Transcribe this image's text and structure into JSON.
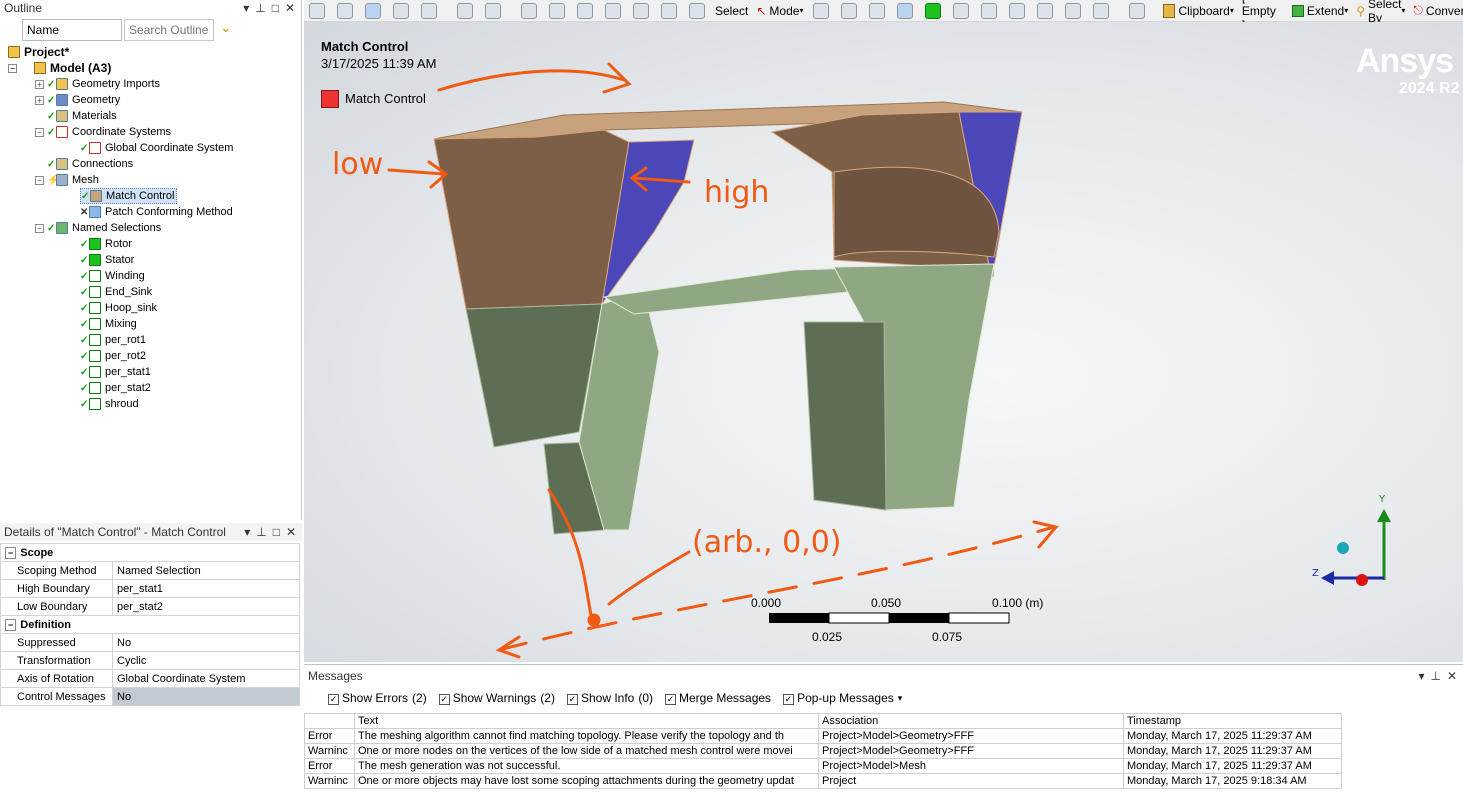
{
  "outline": {
    "title": "Outline",
    "filter_value": "Name",
    "search_placeholder": "Search Outline",
    "tree": [
      {
        "label": "Project*"
      },
      {
        "label": "Model (A3)"
      },
      {
        "label": "Geometry Imports"
      },
      {
        "label": "Geometry"
      },
      {
        "label": "Materials"
      },
      {
        "label": "Coordinate Systems"
      },
      {
        "label": "Global Coordinate System"
      },
      {
        "label": "Connections"
      },
      {
        "label": "Mesh"
      },
      {
        "label": "Match Control"
      },
      {
        "label": "Patch Conforming Method"
      },
      {
        "label": "Named Selections"
      },
      {
        "label": "Rotor"
      },
      {
        "label": "Stator"
      },
      {
        "label": "Winding"
      },
      {
        "label": "End_Sink"
      },
      {
        "label": "Hoop_sink"
      },
      {
        "label": "Mixing"
      },
      {
        "label": "per_rot1"
      },
      {
        "label": "per_rot2"
      },
      {
        "label": "per_stat1"
      },
      {
        "label": "per_stat2"
      },
      {
        "label": "shroud"
      }
    ]
  },
  "details": {
    "title": "Details of \"Match Control\" - Match Control",
    "groups": [
      {
        "name": "Scope",
        "rows": [
          {
            "key": "Scoping Method",
            "value": "Named Selection"
          },
          {
            "key": "High Boundary",
            "value": "per_stat1"
          },
          {
            "key": "Low Boundary",
            "value": "per_stat2"
          }
        ]
      },
      {
        "name": "Definition",
        "rows": [
          {
            "key": "Suppressed",
            "value": "No"
          },
          {
            "key": "Transformation",
            "value": "Cyclic"
          },
          {
            "key": "Axis of Rotation",
            "value": "Global Coordinate System"
          },
          {
            "key": "Control Messages",
            "value": "No"
          }
        ]
      }
    ]
  },
  "toolbar": {
    "select": "Select",
    "mode": "Mode",
    "clipboard": "Clipboard",
    "empty": "[ Empty ]",
    "extend": "Extend",
    "select_by": "Select By",
    "convert": "Convert"
  },
  "viewport": {
    "title": "Match Control",
    "timestamp": "3/17/2025 11:39 AM",
    "legend_label": "Match Control",
    "legend_color": "#ee3333",
    "brand": "Ansys",
    "version": "2024 R2",
    "scale": {
      "top_labels": [
        "0.000",
        "0.050",
        "0.100 (m)"
      ],
      "bottom_labels": [
        "0.025",
        "0.075"
      ]
    },
    "triad": {
      "y": "Y",
      "z": "Z"
    },
    "annotations": {
      "low": "low",
      "high": "high",
      "point": "(arb., 0,0)"
    },
    "colors": {
      "face": "#7d5f48",
      "top": "#c8a27c",
      "boundary": "#4b47b8",
      "lower_dark": "#5d6e55",
      "lower_light": "#8fa883",
      "ink": "#f05a14"
    }
  },
  "messages": {
    "title": "Messages",
    "show_errors": "Show Errors",
    "errors_count": "(2)",
    "show_warnings": "Show Warnings",
    "warnings_count": "(2)",
    "show_info": "Show Info",
    "info_count": "(0)",
    "merge": "Merge Messages",
    "popup": "Pop-up Messages",
    "columns": [
      "Text",
      "Association",
      "Timestamp"
    ],
    "rows": [
      {
        "type": "Error",
        "text": "The meshing algorithm cannot find matching topology. Please verify the topology and th",
        "assoc": "Project>Model>Geometry>FFF",
        "time": "Monday, March 17, 2025 11:29:37 AM"
      },
      {
        "type": "Warninc",
        "text": "One or more nodes on the vertices of the low side of a matched mesh control were movei",
        "assoc": "Project>Model>Geometry>FFF",
        "time": "Monday, March 17, 2025 11:29:37 AM"
      },
      {
        "type": "Error",
        "text": "The mesh generation was not successful.",
        "assoc": "Project>Model>Mesh",
        "time": "Monday, March 17, 2025 11:29:37 AM"
      },
      {
        "type": "Warninc",
        "text": "One or more objects may have lost some scoping attachments during the geometry updat",
        "assoc": "Project",
        "time": "Monday, March 17, 2025 9:18:34 AM"
      }
    ]
  }
}
